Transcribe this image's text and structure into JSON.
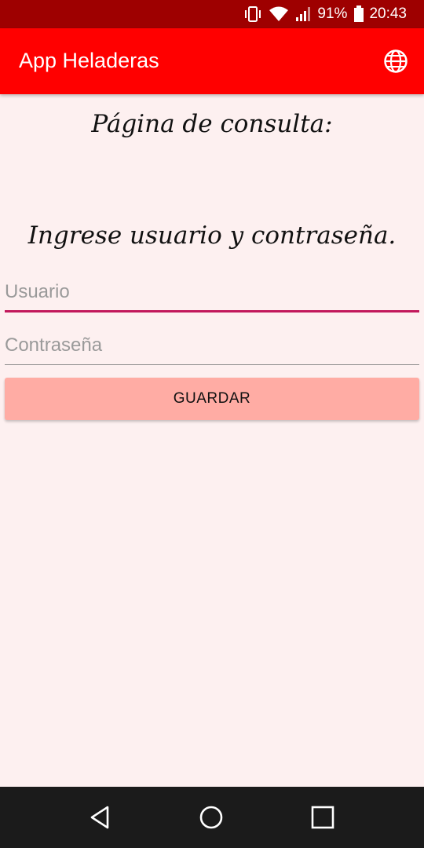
{
  "status_bar": {
    "battery": "91%",
    "time": "20:43",
    "icons": [
      "vibrate-icon",
      "wifi-icon",
      "signal-icon",
      "battery-icon"
    ]
  },
  "app_bar": {
    "title": "App Heladeras",
    "action_icon": "globe-icon"
  },
  "content": {
    "page_heading": "Página de consulta:",
    "instruction": "Ingrese usuario y contraseña.",
    "username": {
      "placeholder": "Usuario",
      "value": ""
    },
    "password": {
      "placeholder": "Contraseña",
      "value": ""
    },
    "save_label": "GUARDAR"
  },
  "nav_bar": {
    "icons": [
      "back-icon",
      "home-icon",
      "recent-apps-icon"
    ]
  },
  "colors": {
    "status_bar": "#9e0000",
    "app_bar": "#ff0000",
    "background": "#fdf0f0",
    "button": "#ffaca4",
    "focus_underline": "#c2185b",
    "nav_bar": "#1b1b1b"
  }
}
